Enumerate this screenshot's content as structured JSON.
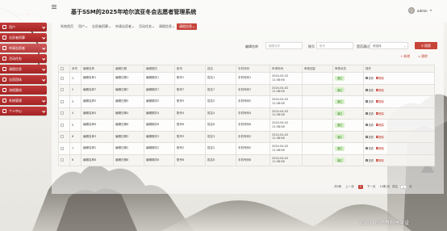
{
  "app": {
    "title": "基于SSM的2025年哈尔滨亚冬会志愿者管理系统"
  },
  "user": {
    "name": "admin"
  },
  "colors": {
    "accent": "#c7443b",
    "sidebar": "#a42424",
    "badge_bg": "#d7f1cb"
  },
  "sidebar": {
    "items": [
      {
        "label": "用户",
        "icon": "user-icon",
        "has_arrow": true
      },
      {
        "label": "志愿者招募",
        "icon": "recruit-icon",
        "has_arrow": true
      },
      {
        "label": "申请志愿者",
        "icon": "apply-icon",
        "has_arrow": true
      },
      {
        "label": "活动任务",
        "icon": "task-icon",
        "has_arrow": true
      },
      {
        "label": "请假信息",
        "icon": "leave-icon",
        "has_arrow": true
      },
      {
        "label": "志愿团体",
        "icon": "team-icon",
        "has_arrow": true
      },
      {
        "label": "流程跟进",
        "icon": "flow-icon",
        "has_arrow": false
      },
      {
        "label": "系统管理",
        "icon": "system-icon",
        "has_arrow": true
      },
      {
        "label": "个人中心",
        "icon": "profile-icon",
        "has_arrow": true
      }
    ]
  },
  "tabs": [
    {
      "label": "系统首页",
      "dropdown": false
    },
    {
      "label": "用户",
      "dropdown": true
    },
    {
      "label": "志愿者招募",
      "dropdown": true
    },
    {
      "label": "申请志愿者",
      "dropdown": true
    },
    {
      "label": "活动任务",
      "dropdown": true
    },
    {
      "label": "请假信息",
      "dropdown": true
    },
    {
      "label": "请假信息",
      "dropdown": true
    }
  ],
  "search": {
    "field1_label": "编辑名称",
    "field1_placeholder": "编辑名称",
    "field2_label": "账号",
    "field2_placeholder": "账号",
    "field3_label": "是否通过",
    "field3_value": "请选择",
    "button_label": "搜索"
  },
  "ops": {
    "add": "新增",
    "delete": "删除"
  },
  "table": {
    "headers": [
      "",
      "序号",
      "编辑名称",
      "编辑日期",
      "编辑期次",
      "账号",
      "姓名",
      "手机号码",
      "申请时间",
      "审核回复",
      "审核状态",
      "操作"
    ],
    "rows": [
      [
        "1",
        "编辑名称1",
        "编辑日期1",
        "编辑期次1",
        "账号1",
        "姓名1",
        "手机号码1",
        "2024-04-02 11:38:58",
        "",
        "通过"
      ],
      [
        "2",
        "编辑名称7",
        "编辑日期7",
        "编辑期次7",
        "账号7",
        "姓名7",
        "手机号码7",
        "2024-04-02 11:38:58",
        "",
        "通过"
      ],
      [
        "3",
        "编辑名称5",
        "编辑日期5",
        "编辑期次5",
        "账号5",
        "姓名5",
        "手机号码5",
        "2024-04-02 11:38:58",
        "",
        "通过"
      ],
      [
        "4",
        "编辑名称4",
        "编辑日期4",
        "编辑期次4",
        "账号4",
        "姓名4",
        "手机号码4",
        "2024-04-02 11:38:58",
        "",
        "通过"
      ],
      [
        "5",
        "编辑名称6",
        "编辑日期6",
        "编辑期次6",
        "账号6",
        "姓名6",
        "手机号码6",
        "2024-04-02 11:38:58",
        "",
        "通过"
      ],
      [
        "6",
        "编辑名称3",
        "编辑日期3",
        "编辑期次3",
        "账号3",
        "姓名3",
        "手机号码3",
        "2024-04-02 11:38:58",
        "",
        "通过"
      ],
      [
        "7",
        "编辑名称2",
        "编辑日期2",
        "编辑期次2",
        "账号2",
        "姓名2",
        "手机号码2",
        "2024-04-02 11:38:58",
        "",
        "通过"
      ],
      [
        "8",
        "编辑名称8",
        "编辑日期8",
        "编辑期次8",
        "账号8",
        "姓名8",
        "手机号码8",
        "2024-04-02 11:38:58",
        "",
        "通过"
      ]
    ],
    "action_view": "查看",
    "action_delete": "删除"
  },
  "pagination": {
    "total": "共8条",
    "prev": "上一页",
    "current": "1",
    "next": "下一页",
    "page_size": "10条/页",
    "goto_label": "前往",
    "goto_value": "1",
    "page_unit": "页"
  },
  "watermark": "CSDN @杰哥程序毕设"
}
